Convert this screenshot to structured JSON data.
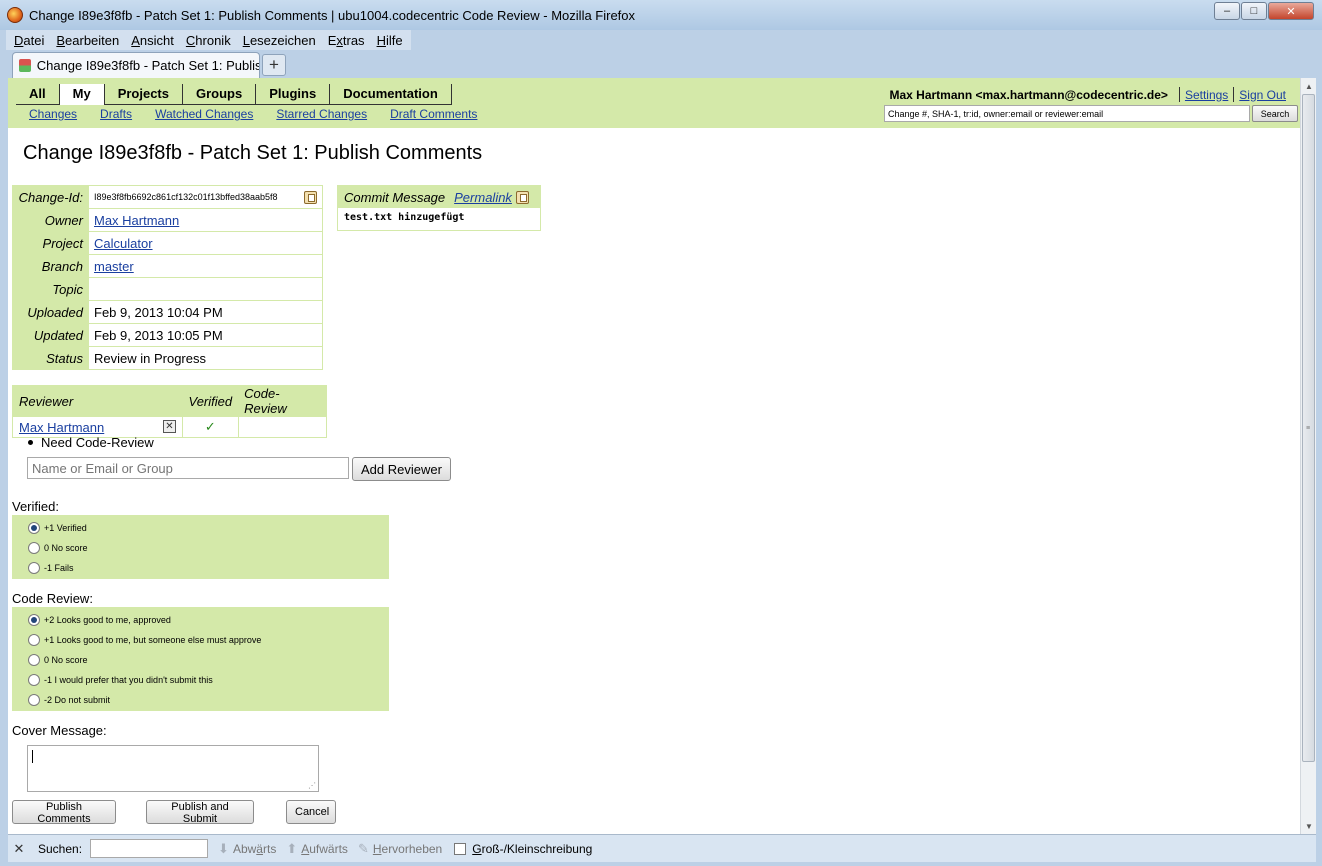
{
  "window": {
    "title": "Change I89e3f8fb - Patch Set 1: Publish Comments | ubu1004.codecentric Code Review - Mozilla Firefox",
    "minimize": "–",
    "maximize": "□",
    "close": "✕"
  },
  "menubar": {
    "items": [
      {
        "u": "D",
        "rest": "atei"
      },
      {
        "u": "B",
        "rest": "earbeiten"
      },
      {
        "u": "A",
        "rest": "nsicht"
      },
      {
        "u": "C",
        "rest": "hronik"
      },
      {
        "u": "L",
        "rest": "esezeichen"
      },
      {
        "pre": "E",
        "u": "x",
        "rest": "tras"
      },
      {
        "u": "H",
        "rest": "ilfe"
      }
    ]
  },
  "tab": {
    "label": "Change I89e3f8fb - Patch Set 1: Publish ...",
    "new_tab": "+"
  },
  "gerrit": {
    "topmenu": [
      "All",
      "My",
      "Projects",
      "Groups",
      "Plugins",
      "Documentation"
    ],
    "submenu": [
      "Changes",
      "Drafts",
      "Watched Changes",
      "Starred Changes",
      "Draft Comments"
    ],
    "user": "Max Hartmann <max.hartmann@codecentric.de>",
    "settings": "Settings",
    "signout": "Sign Out",
    "search_value": "Change #, SHA-1, tr:id, owner:email or reviewer:email",
    "search_button": "Search"
  },
  "page_title": "Change I89e3f8fb - Patch Set 1: Publish Comments",
  "info": {
    "change_id_label": "Change-Id:",
    "change_id": "I89e3f8fb6692c861cf132c01f13bffed38aab5f8",
    "owner_label": "Owner",
    "owner": "Max Hartmann",
    "project_label": "Project",
    "project": "Calculator",
    "branch_label": "Branch",
    "branch": "master",
    "topic_label": "Topic",
    "topic": "",
    "uploaded_label": "Uploaded",
    "uploaded": "Feb 9, 2013 10:04 PM",
    "updated_label": "Updated",
    "updated": "Feb 9, 2013 10:05 PM",
    "status_label": "Status",
    "status": "Review in Progress"
  },
  "commit": {
    "label": "Commit Message",
    "permalink": "Permalink",
    "message": "test.txt hinzugefügt"
  },
  "reviewers": {
    "headers": [
      "Reviewer",
      "Verified",
      "Code-Review"
    ],
    "rows": [
      {
        "name": "Max Hartmann",
        "remove": "✕",
        "verified": "✓",
        "code_review": ""
      }
    ],
    "need": "Need Code-Review",
    "add_placeholder": "Name or Email or Group",
    "add_button": "Add Reviewer"
  },
  "verified": {
    "title": "Verified:",
    "options": [
      {
        "label": "+1 Verified",
        "selected": true
      },
      {
        "label": " 0 No score",
        "selected": false
      },
      {
        "label": "-1 Fails",
        "selected": false
      }
    ]
  },
  "code_review": {
    "title": "Code Review:",
    "options": [
      {
        "label": "+2 Looks good to me, approved",
        "selected": true
      },
      {
        "label": "+1 Looks good to me, but someone else must approve",
        "selected": false
      },
      {
        "label": " 0 No score",
        "selected": false
      },
      {
        "label": "-1 I would prefer that you didn't submit this",
        "selected": false
      },
      {
        "label": "-2 Do not submit",
        "selected": false
      }
    ]
  },
  "cover": {
    "title": "Cover Message:",
    "value": ""
  },
  "buttons": {
    "publish": "Publish Comments",
    "publish_submit": "Publish and Submit",
    "cancel": "Cancel"
  },
  "findbar": {
    "close": "✕",
    "label": "Suchen:",
    "down": {
      "pre": "Abw",
      "u": "ä",
      "rest": "rts"
    },
    "up": {
      "u": "A",
      "rest": "ufwärts"
    },
    "highlight": {
      "u": "H",
      "rest": "ervorheben"
    },
    "case": {
      "u": "G",
      "rest": "roß-/Kleinschreibung"
    }
  },
  "colors": {
    "accent": "#d4e9a9",
    "link": "#1a3fa0",
    "check": "#2a8a1d"
  }
}
